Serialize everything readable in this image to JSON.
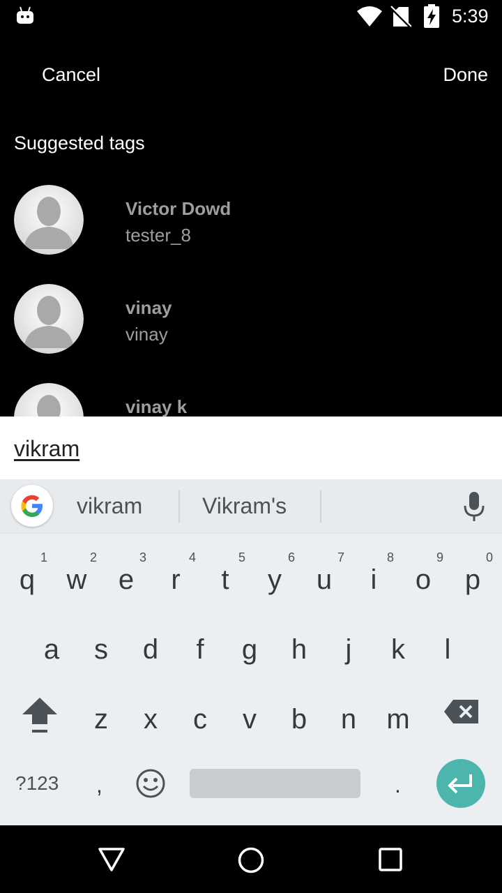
{
  "status_bar": {
    "time": "5:39",
    "icons": [
      "android-icon",
      "wifi-icon",
      "no-signal-icon",
      "battery-charging-icon"
    ]
  },
  "header": {
    "cancel_label": "Cancel",
    "done_label": "Done"
  },
  "section_title": "Suggested tags",
  "suggestions": [
    {
      "name": "Victor Dowd",
      "handle": "tester_8"
    },
    {
      "name": "vinay",
      "handle": "vinay"
    },
    {
      "name": "vinay k",
      "handle": ""
    }
  ],
  "input": {
    "value": "vikram"
  },
  "keyboard": {
    "suggestions": [
      "vikram",
      "Vikram's"
    ],
    "row1": [
      {
        "ch": "q",
        "num": "1"
      },
      {
        "ch": "w",
        "num": "2"
      },
      {
        "ch": "e",
        "num": "3"
      },
      {
        "ch": "r",
        "num": "4"
      },
      {
        "ch": "t",
        "num": "5"
      },
      {
        "ch": "y",
        "num": "6"
      },
      {
        "ch": "u",
        "num": "7"
      },
      {
        "ch": "i",
        "num": "8"
      },
      {
        "ch": "o",
        "num": "9"
      },
      {
        "ch": "p",
        "num": "0"
      }
    ],
    "row2": [
      "a",
      "s",
      "d",
      "f",
      "g",
      "h",
      "j",
      "k",
      "l"
    ],
    "row3": [
      "z",
      "x",
      "c",
      "v",
      "b",
      "n",
      "m"
    ],
    "symbols_label": "?123",
    "comma_label": ",",
    "period_label": ".",
    "accent_color": "#4db6ac"
  },
  "nav_bar": {
    "icons": [
      "back-icon",
      "home-icon",
      "recents-icon"
    ]
  }
}
